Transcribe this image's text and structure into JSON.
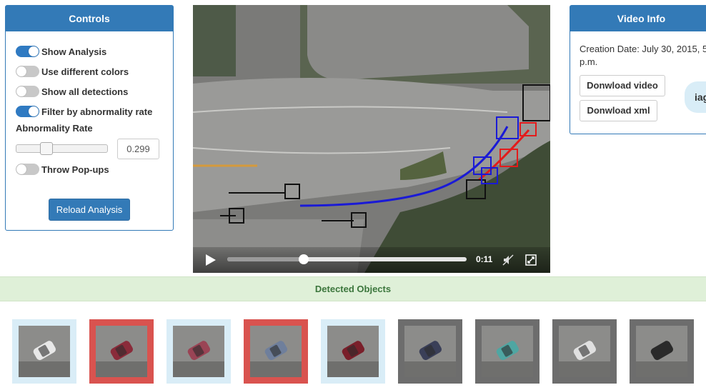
{
  "controls": {
    "title": "Controls",
    "toggles": [
      {
        "label": "Show Analysis",
        "on": true
      },
      {
        "label": "Use different colors",
        "on": false
      },
      {
        "label": "Show all detections",
        "on": false
      },
      {
        "label": "Filter by abnormality rate",
        "on": true
      }
    ],
    "rate_label": "Abnormality Rate",
    "rate_value": "0.299",
    "rate_slider_fraction": 0.299,
    "popups_label": "Throw Pop-ups",
    "popups_on": false,
    "reload_label": "Reload Analysis"
  },
  "video_info": {
    "title": "Video Info",
    "creation_date": "Creation Date: July 30, 2015, 5:",
    "creation_date_cont": "p.m.",
    "download_video": "Donwload video",
    "download_xml": "Donwload xml",
    "pill_text": "iag"
  },
  "player": {
    "time": "0:11",
    "progress_fraction": 0.32,
    "icons": [
      "play-icon",
      "mute-icon",
      "fullscreen-icon"
    ]
  },
  "detected": {
    "title": "Detected Objects",
    "thumbnails": [
      {
        "border": "#d9edf7",
        "car_color": "#e8e8e8"
      },
      {
        "border": "#d9534f",
        "car_color": "#8a2b3a"
      },
      {
        "border": "#d9edf7",
        "car_color": "#9a4455"
      },
      {
        "border": "#d9534f",
        "car_color": "#6f7f9c"
      },
      {
        "border": "#d9edf7",
        "car_color": "#7a1f2a"
      },
      {
        "border": "#6d6d6d",
        "car_color": "#3a3f58"
      },
      {
        "border": "#6d6d6d",
        "car_color": "#4fa6a2"
      },
      {
        "border": "#6d6d6d",
        "car_color": "#e0e0e0"
      },
      {
        "border": "#6d6d6d",
        "car_color": "#2a2a2a"
      }
    ]
  }
}
